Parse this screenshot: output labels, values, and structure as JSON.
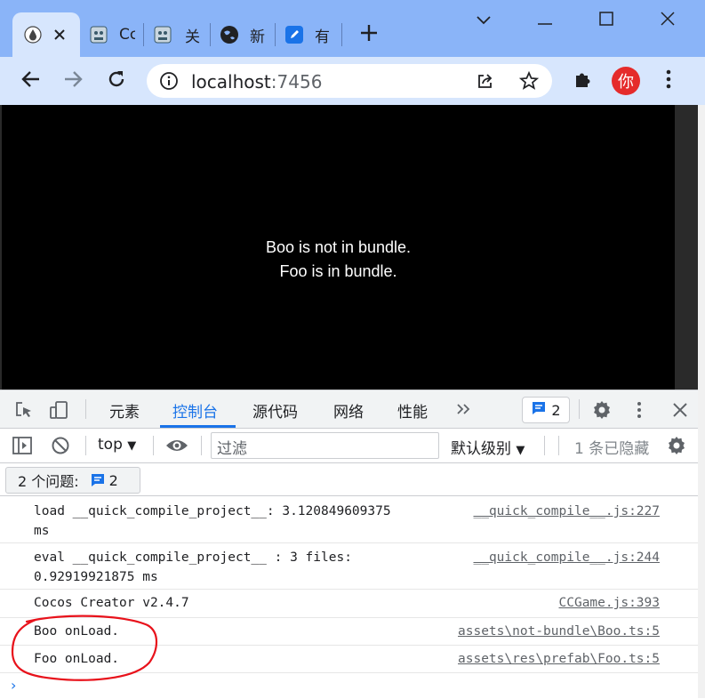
{
  "tabs": [
    {
      "title": "",
      "active": true,
      "icon": "drop-icon"
    },
    {
      "title": "Cc",
      "icon": "cocos-icon"
    },
    {
      "title": "关",
      "icon": "cocos-icon"
    },
    {
      "title": "新",
      "icon": "globe-icon"
    },
    {
      "title": "有",
      "icon": "edit-icon"
    }
  ],
  "url": {
    "host": "localhost",
    "port": ":7456"
  },
  "profile": {
    "initial": "你"
  },
  "game": {
    "line1": "Boo is not in bundle.",
    "line2": "Foo is in bundle."
  },
  "devtools": {
    "tabs": [
      "元素",
      "控制台",
      "源代码",
      "网络",
      "性能"
    ],
    "active_tab": "控制台",
    "issue_count": "2",
    "context": "top",
    "filter_placeholder": "过滤",
    "levels": "默认级别",
    "hidden": "1 条已隐藏",
    "issues_label": "2 个问题:",
    "issues_count": "2"
  },
  "console": [
    {
      "text": "load __quick_compile_project__: 3.120849609375\nms",
      "source": "__quick_compile__.js:227"
    },
    {
      "text": "eval __quick_compile_project__ : 3 files:\n0.92919921875 ms",
      "source": "__quick_compile__.js:244"
    },
    {
      "text": "Cocos Creator v2.4.7",
      "source": "CCGame.js:393"
    },
    {
      "text": "Boo onLoad.",
      "source": "assets\\not-bundle\\Boo.ts:5"
    },
    {
      "text": "Foo onLoad.",
      "source": "assets\\res\\prefab\\Foo.ts:5"
    }
  ],
  "colors": {
    "accent": "#1a73e8",
    "annotation": "#e8121b",
    "chrome": "#d7e6fd",
    "tabstrip": "#8ab4f8"
  }
}
